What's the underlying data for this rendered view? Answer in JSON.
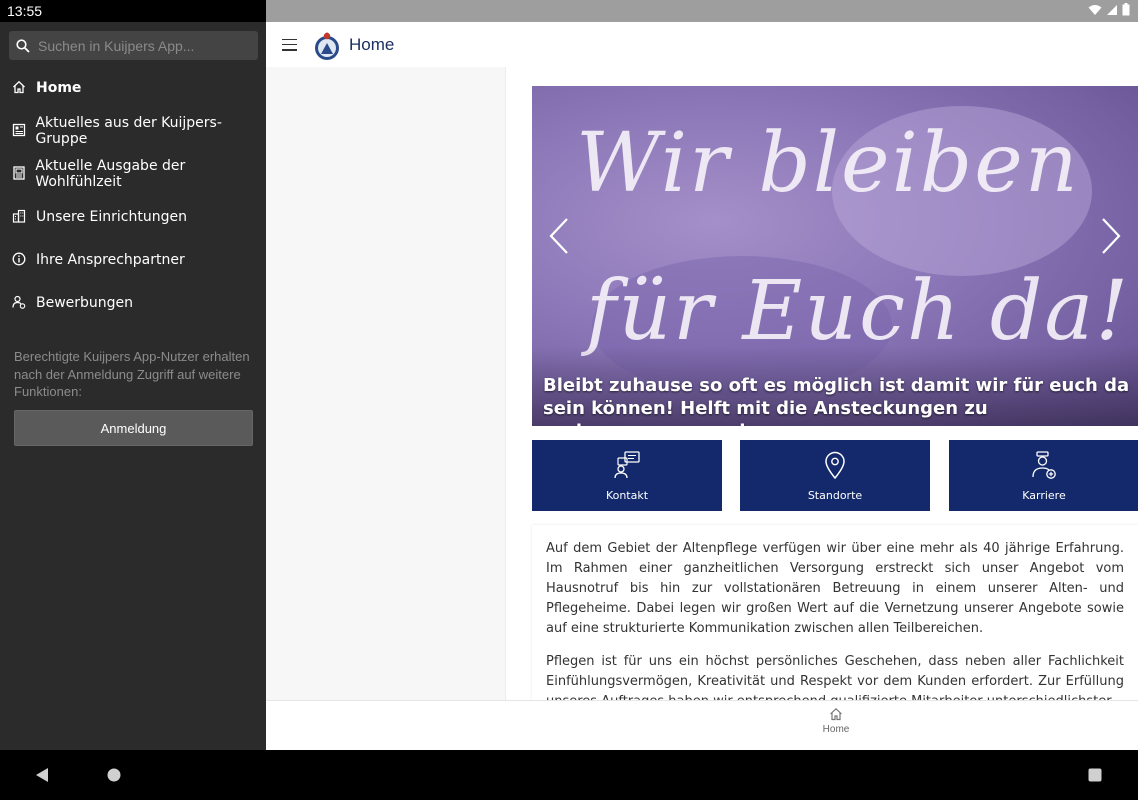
{
  "status_bar": {
    "time": "13:55"
  },
  "drawer": {
    "search_placeholder": "Suchen in Kuijpers App...",
    "items": [
      {
        "label": "Home",
        "icon": "home-icon",
        "active": true
      },
      {
        "label": "Aktuelles aus der Kuijpers-Gruppe",
        "icon": "news-icon"
      },
      {
        "label": "Aktuelle Ausgabe der Wohlfühlzeit",
        "icon": "magazine-icon"
      },
      {
        "label": "Unsere Einrichtungen",
        "icon": "buildings-icon"
      },
      {
        "label": "Ihre Ansprechpartner",
        "icon": "info-icon"
      },
      {
        "label": "Bewerbungen",
        "icon": "applicant-icon"
      }
    ],
    "note": "Berechtigte Kuijpers App-Nutzer erhalten nach der Anmeldung Zugriff auf weitere Funktionen:",
    "login_label": "Anmeldung"
  },
  "appbar": {
    "title": "Home"
  },
  "hero": {
    "image_text_line1": "Wir bleiben",
    "image_text_line2": "für Euch da!",
    "caption": "Bleibt zuhause so oft es möglich ist damit wir für euch da sein können! Helft mit die Ansteckungen zu verlangsamen...und..."
  },
  "tiles": [
    {
      "label": "Kontakt",
      "icon": "contact-icon"
    },
    {
      "label": "Standorte",
      "icon": "location-pin-icon"
    },
    {
      "label": "Karriere",
      "icon": "career-icon"
    }
  ],
  "text": {
    "p1": "Auf dem Gebiet der Altenpflege verfügen wir über eine mehr als 40 jährige Erfahrung. Im Rahmen einer ganzheitlichen Versorgung erstreckt sich unser Angebot vom Hausnotruf bis hin zur vollstationären Betreuung in einem unserer Alten- und Pflegeheime. Dabei legen wir großen Wert auf die Vernetzung unserer Angebote sowie auf eine strukturierte Kommunikation zwischen allen Teilbereichen.",
    "p2": "Pflegen ist für uns ein höchst persönliches Geschehen, dass neben aller Fachlichkeit Einfühlungsvermögen, Kreativität und Respekt vor dem Kunden erfordert. Zur Erfüllung unseres Auftrages haben wir entsprechend qualifizierte Mitarbeiter unterschiedlichster"
  },
  "bottom_nav": {
    "home_label": "Home"
  },
  "colors": {
    "brand_navy": "#13296b",
    "drawer_bg": "#2b2b2b"
  }
}
